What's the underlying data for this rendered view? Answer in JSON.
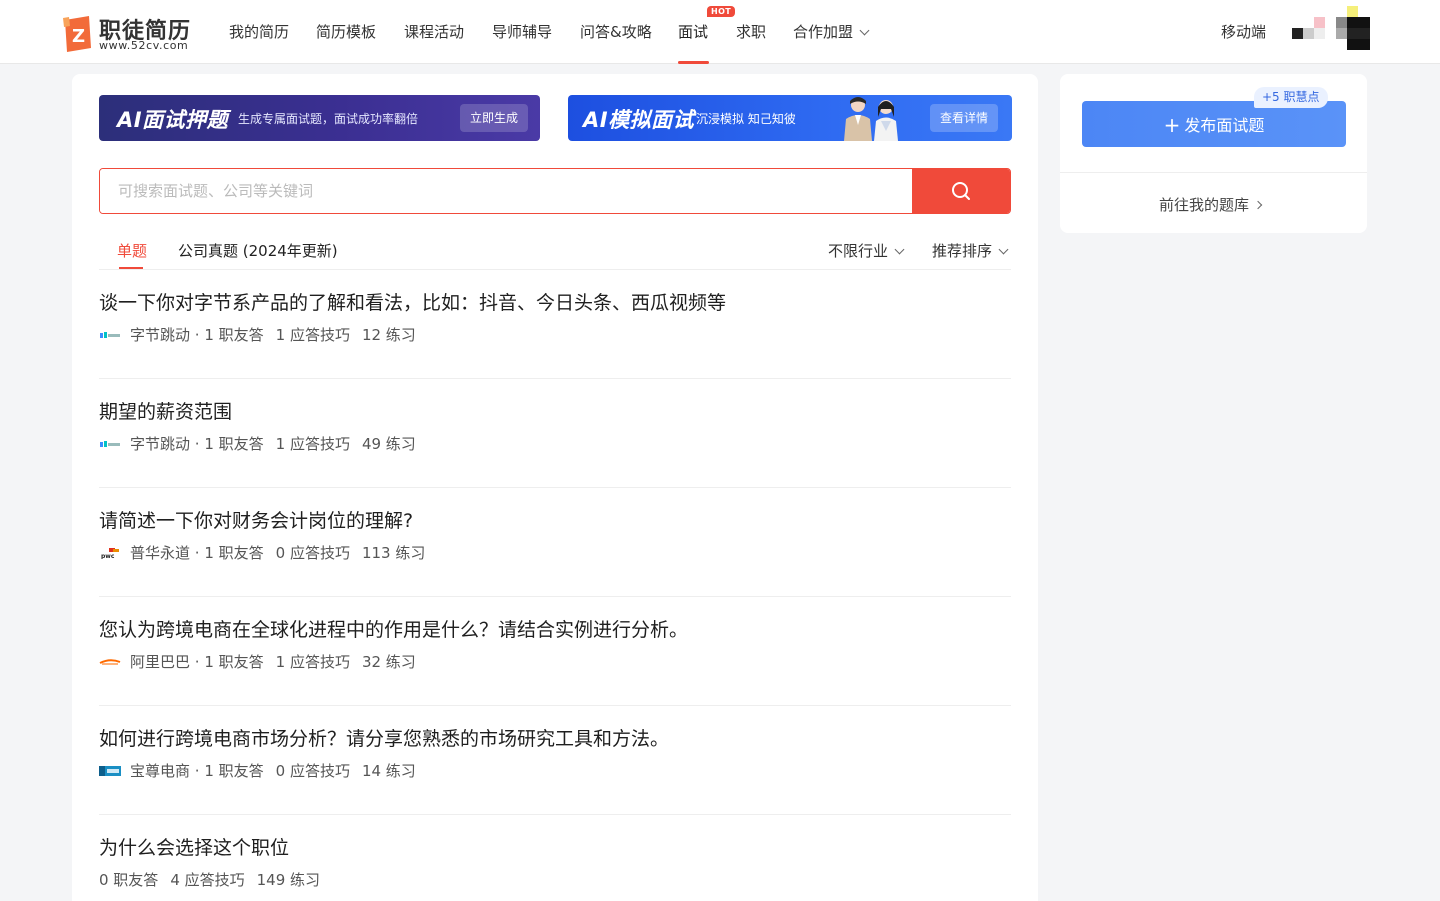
{
  "brand": {
    "title": "职徒简历",
    "subtitle": "www.52cv.com"
  },
  "nav": {
    "items": [
      "我的简历",
      "简历模板",
      "课程活动",
      "导师辅导",
      "问答&攻略",
      "面试",
      "求职",
      "合作加盟"
    ],
    "active": "面试",
    "hot_badge": "HOT",
    "mobile": "移动端"
  },
  "banners": [
    {
      "title": "AI面试押题",
      "desc": "生成专属面试题，面试成功率翻倍",
      "button": "立即生成"
    },
    {
      "title": "AI模拟面试",
      "desc": "沉浸模拟 知己知彼",
      "button": "查看详情"
    }
  ],
  "search": {
    "placeholder": "可搜索面试题、公司等关键词"
  },
  "tabs": {
    "single": "单题",
    "company": "公司真题 (2024年更新)"
  },
  "filters": {
    "industry": "不限行业",
    "sort": "推荐排序"
  },
  "questions": [
    {
      "title": "谈一下你对字节系产品的了解和看法，比如：抖音、今日头条、西瓜视频等",
      "company": "字节跳动",
      "answers": "1 职友答",
      "tips": "1 应答技巧",
      "practice": "12 练习"
    },
    {
      "title": "期望的薪资范围",
      "company": "字节跳动",
      "answers": "1 职友答",
      "tips": "1 应答技巧",
      "practice": "49 练习"
    },
    {
      "title": "请简述一下你对财务会计岗位的理解?",
      "company": "普华永道",
      "answers": "1 职友答",
      "tips": "0 应答技巧",
      "practice": "113 练习"
    },
    {
      "title": "您认为跨境电商在全球化进程中的作用是什么？请结合实例进行分析。",
      "company": "阿里巴巴",
      "answers": "1 职友答",
      "tips": "1 应答技巧",
      "practice": "32 练习"
    },
    {
      "title": "如何进行跨境电商市场分析？请分享您熟悉的市场研究工具和方法。",
      "company": "宝尊电商",
      "answers": "1 职友答",
      "tips": "0 应答技巧",
      "practice": "14 练习"
    },
    {
      "title": "为什么会选择这个职位",
      "company": "",
      "answers": "0 职友答",
      "tips": "4 应答技巧",
      "practice": "149 练习"
    }
  ],
  "sidebar": {
    "publish_button": "发布面试题",
    "points_badge": "+5 职慧点",
    "my_bank_link": "前往我的题库"
  },
  "colors": {
    "accent": "#f04a3a",
    "blue": "#4c86f5"
  }
}
